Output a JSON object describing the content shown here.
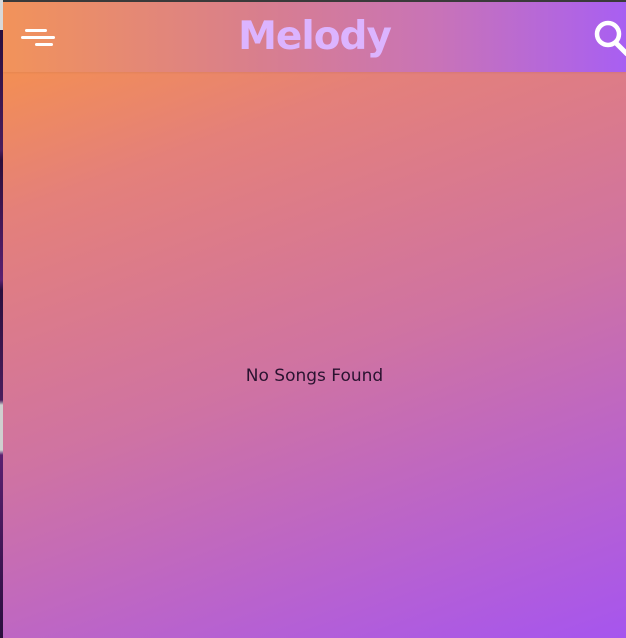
{
  "app": {
    "title": "Melody",
    "title_color": "#dcb4ff",
    "gradient_colors": [
      "#fb9640",
      "#e4807a",
      "#cf73a2",
      "#b45fd6",
      "#a655ee"
    ]
  },
  "header": {
    "menu_icon": "menu-icon",
    "search_icon": "search-icon"
  },
  "main": {
    "empty_message": "No Songs Found"
  }
}
